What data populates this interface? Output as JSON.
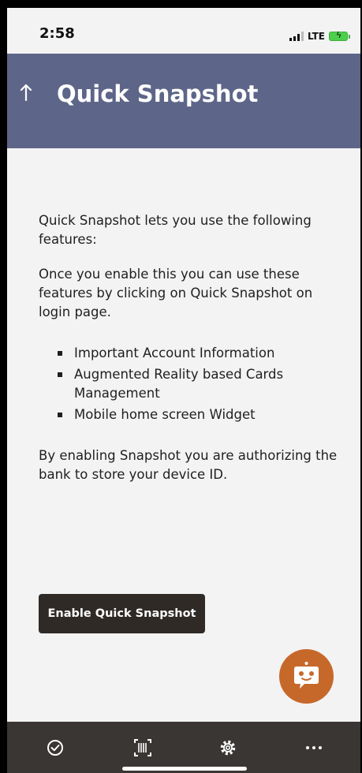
{
  "status_bar": {
    "time": "2:58",
    "network": "LTE",
    "icons": [
      "signal-icon",
      "battery-charging-icon"
    ]
  },
  "header": {
    "back_icon": "up-arrow-icon",
    "title": "Quick Snapshot",
    "background_color": "#5d6688"
  },
  "content": {
    "intro": "Quick Snapshot lets you use the following features:",
    "instruction": "Once you enable this you can use these features by clicking on Quick Snapshot on login page.",
    "features": [
      "Important Account Information",
      "Augmented Reality based Cards Management",
      "Mobile home screen Widget"
    ],
    "disclaimer": "By enabling Snapshot you are authorizing the bank to store your device ID."
  },
  "actions": {
    "enable_label": "Enable Quick Snapshot",
    "button_color": "#2f2a26"
  },
  "chatbot": {
    "icon": "chatbot-icon",
    "color": "#c7682b"
  },
  "tab_bar": {
    "background_color": "#3a3633",
    "items": [
      {
        "icon": "check-circle-icon"
      },
      {
        "icon": "scan-icon"
      },
      {
        "icon": "settings-icon"
      },
      {
        "icon": "more-icon"
      }
    ]
  }
}
